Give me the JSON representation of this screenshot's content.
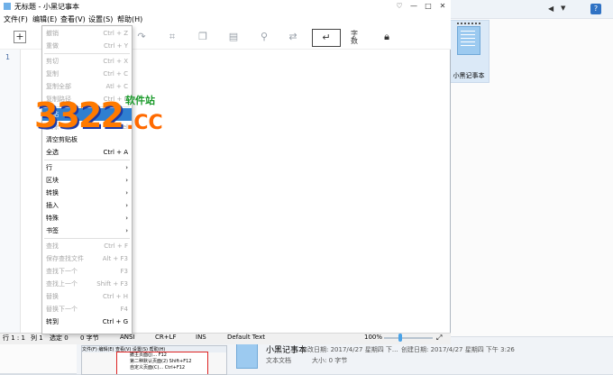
{
  "window": {
    "title": "无标题 - 小黑记事本"
  },
  "title_buttons": {
    "heart": "♡",
    "minimize": "—",
    "maximize": "□",
    "close": "✕"
  },
  "menubar": [
    "文件(F)",
    "编辑(E)",
    "查看(V)",
    "设置(S)",
    "帮助(H)"
  ],
  "toolbar": {
    "font_label": "字\n数"
  },
  "editor": {
    "line_number": "1"
  },
  "edit_menu": {
    "items": [
      {
        "label": "撤销",
        "shortcut": "Ctrl + Z",
        "disabled": true
      },
      {
        "label": "重做",
        "shortcut": "Ctrl + Y",
        "disabled": true
      },
      {
        "label": "剪切",
        "shortcut": "Ctrl + X",
        "disabled": true
      },
      {
        "label": "复制",
        "shortcut": "Ctrl + C",
        "disabled": true
      },
      {
        "label": "复制全部",
        "shortcut": "Atl + C",
        "disabled": true
      },
      {
        "label": "复制路径",
        "shortcut": "Ctrl + E",
        "disabled": true
      },
      {
        "label": "粘贴",
        "shortcut": "",
        "disabled": false,
        "highlighted": true
      },
      {
        "label": "删除",
        "shortcut": "Del",
        "disabled": true
      },
      {
        "label": "清空剪贴板",
        "shortcut": "",
        "disabled": false
      },
      {
        "label": "全选",
        "shortcut": "Ctrl + A",
        "disabled": false
      },
      {
        "label": "行",
        "shortcut": "›",
        "disabled": false
      },
      {
        "label": "区块",
        "shortcut": "›",
        "disabled": false
      },
      {
        "label": "转换",
        "shortcut": "›",
        "disabled": false
      },
      {
        "label": "插入",
        "shortcut": "›",
        "disabled": false
      },
      {
        "label": "特殊",
        "shortcut": "›",
        "disabled": false
      },
      {
        "label": "书签",
        "shortcut": "›",
        "disabled": false
      },
      {
        "label": "查找",
        "shortcut": "Ctrl + F",
        "disabled": true
      },
      {
        "label": "保存查找文件",
        "shortcut": "Alt + F3",
        "disabled": true
      },
      {
        "label": "查找下一个",
        "shortcut": "F3",
        "disabled": true
      },
      {
        "label": "查找上一个",
        "shortcut": "Shift + F3",
        "disabled": true
      },
      {
        "label": "替换",
        "shortcut": "Ctrl + H",
        "disabled": true
      },
      {
        "label": "替换下一个",
        "shortcut": "F4",
        "disabled": true
      },
      {
        "label": "转到",
        "shortcut": "Ctrl + G",
        "disabled": false
      }
    ]
  },
  "statusbar": {
    "row": "行 1 : 1",
    "col": "列 1",
    "selection": "选定 0",
    "bytes": "0 字节",
    "encoding": "ANSI",
    "eol": "CR+LF",
    "mode": "INS",
    "highlighter": "Default Text",
    "zoom": "100%",
    "zoom_level": 0.3
  },
  "explorer": {
    "file_label": "小黑记事本",
    "detail_name": "小黑记事本",
    "detail_type": "文本文档",
    "detail_modified": "修改日期: 2017/4/27 星期四 下...",
    "detail_size": "大小: 0 字节",
    "detail_created": "创建日期: 2017/4/27 星期四 下午 3:26",
    "help_icon": "?"
  },
  "thumbnail": {
    "menu": "文件(F)  编辑(E)  查看(V)  设置(S)  帮助(H)",
    "rows": [
      "撤主页面(J)...      F12",
      "第二种默认页面(2)   Shift+F12",
      "自定义页面(C)...   Ctrl+F12"
    ]
  },
  "watermark": {
    "number": "3322",
    "site": "软件站",
    "domain": ".CC"
  }
}
